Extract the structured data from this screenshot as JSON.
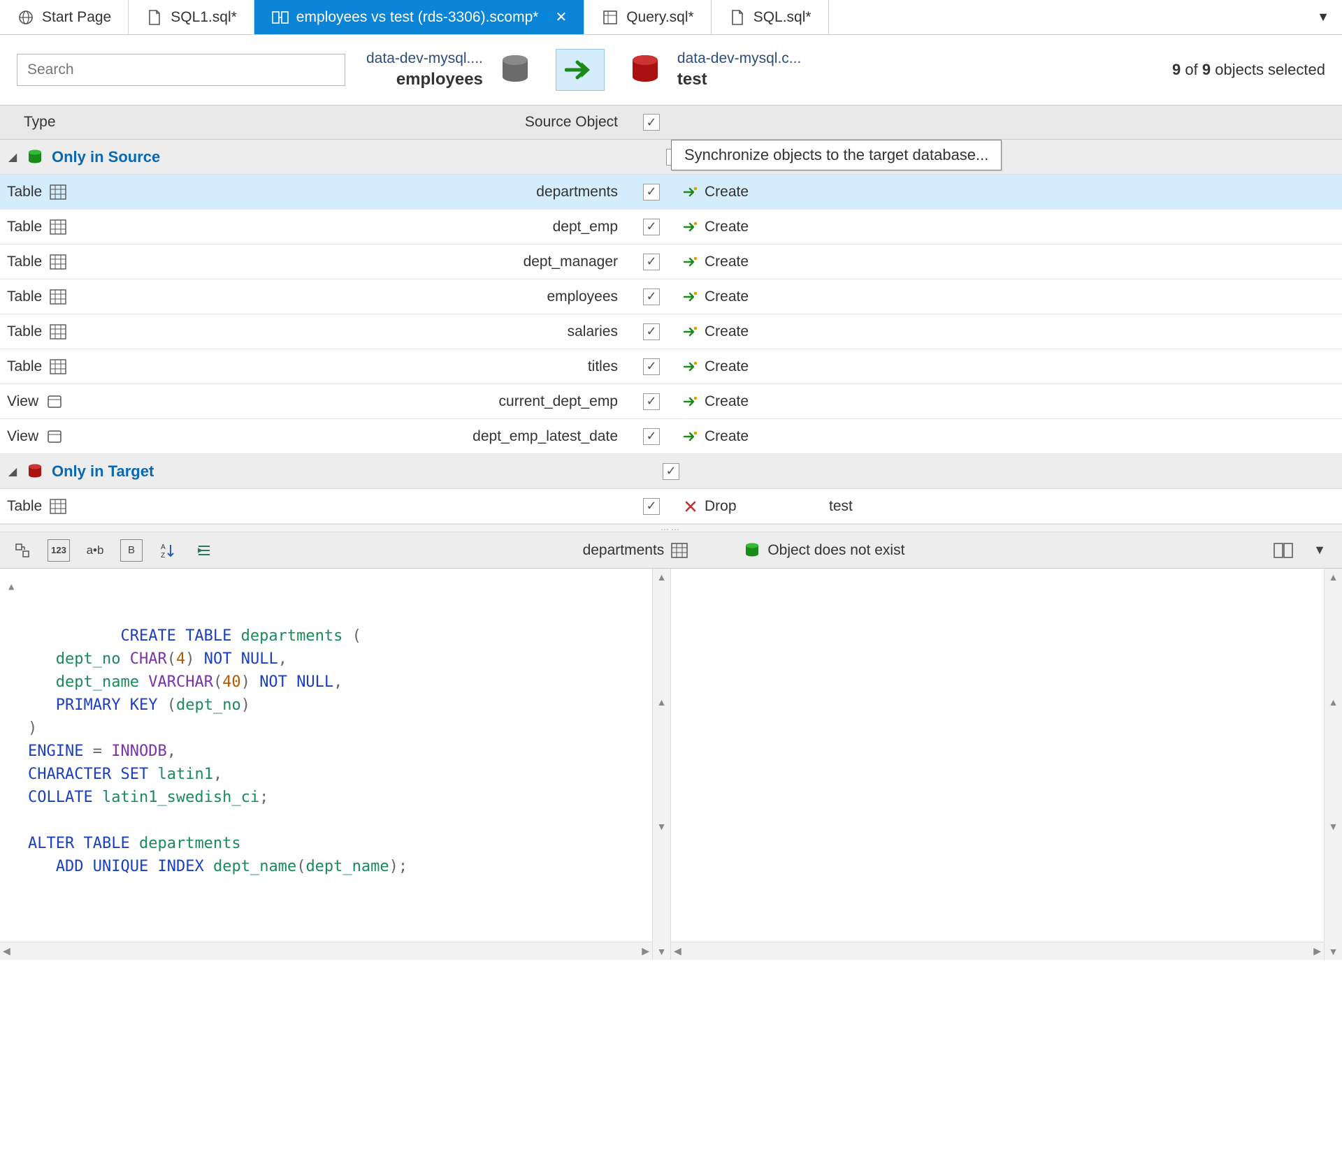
{
  "tabs": [
    {
      "label": "Start Page",
      "icon": "globe"
    },
    {
      "label": "SQL1.sql*",
      "icon": "sqlfile"
    },
    {
      "label": "employees vs test (rds-3306).scomp*",
      "icon": "compare",
      "active": true,
      "closable": true
    },
    {
      "label": "Query.sql*",
      "icon": "query"
    },
    {
      "label": "SQL.sql*",
      "icon": "sqlfile"
    }
  ],
  "search": {
    "placeholder": "Search"
  },
  "source": {
    "server": "data-dev-mysql....",
    "db": "employees"
  },
  "target": {
    "server": "data-dev-mysql.c...",
    "db": "test"
  },
  "sel_count": "9",
  "sel_total": "9",
  "sel_suffix": "objects selected",
  "tooltip": "Synchronize objects to the target database...",
  "cols": {
    "type": "Type",
    "src": "Source Object"
  },
  "groups": {
    "source": "Only in Source",
    "target": "Only in Target"
  },
  "rows_source": [
    {
      "type": "Table",
      "icon": "table",
      "name": "departments",
      "action": "Create",
      "selected": true
    },
    {
      "type": "Table",
      "icon": "table",
      "name": "dept_emp",
      "action": "Create"
    },
    {
      "type": "Table",
      "icon": "table",
      "name": "dept_manager",
      "action": "Create"
    },
    {
      "type": "Table",
      "icon": "table",
      "name": "employees",
      "action": "Create"
    },
    {
      "type": "Table",
      "icon": "table",
      "name": "salaries",
      "action": "Create"
    },
    {
      "type": "Table",
      "icon": "table",
      "name": "titles",
      "action": "Create"
    },
    {
      "type": "View",
      "icon": "view",
      "name": "current_dept_emp",
      "action": "Create"
    },
    {
      "type": "View",
      "icon": "view",
      "name": "dept_emp_latest_date",
      "action": "Create"
    }
  ],
  "rows_target": [
    {
      "type": "Table",
      "icon": "table",
      "name": "",
      "action": "Drop",
      "target_name": "test"
    }
  ],
  "bottom": {
    "left_label": "departments",
    "right_label": "Object does not exist"
  },
  "sql_tokens": [
    [
      "kw",
      "CREATE"
    ],
    [
      "sp",
      " "
    ],
    [
      "kw",
      "TABLE"
    ],
    [
      "sp",
      " "
    ],
    [
      "id",
      "departments"
    ],
    [
      "sp",
      " "
    ],
    [
      "pn",
      "("
    ],
    [
      "nl"
    ],
    [
      "sp",
      "   "
    ],
    [
      "id",
      "dept_no"
    ],
    [
      "sp",
      " "
    ],
    [
      "ty",
      "CHAR"
    ],
    [
      "pn",
      "("
    ],
    [
      "num",
      "4"
    ],
    [
      "pn",
      ")"
    ],
    [
      "sp",
      " "
    ],
    [
      "kw",
      "NOT"
    ],
    [
      "sp",
      " "
    ],
    [
      "kw",
      "NULL"
    ],
    [
      "pn",
      ","
    ],
    [
      "nl"
    ],
    [
      "sp",
      "   "
    ],
    [
      "id",
      "dept_name"
    ],
    [
      "sp",
      " "
    ],
    [
      "ty",
      "VARCHAR"
    ],
    [
      "pn",
      "("
    ],
    [
      "num",
      "40"
    ],
    [
      "pn",
      ")"
    ],
    [
      "sp",
      " "
    ],
    [
      "kw",
      "NOT"
    ],
    [
      "sp",
      " "
    ],
    [
      "kw",
      "NULL"
    ],
    [
      "pn",
      ","
    ],
    [
      "nl"
    ],
    [
      "sp",
      "   "
    ],
    [
      "kw",
      "PRIMARY"
    ],
    [
      "sp",
      " "
    ],
    [
      "kw",
      "KEY"
    ],
    [
      "sp",
      " "
    ],
    [
      "pn",
      "("
    ],
    [
      "id",
      "dept_no"
    ],
    [
      "pn",
      ")"
    ],
    [
      "nl"
    ],
    [
      "pn",
      ")"
    ],
    [
      "nl"
    ],
    [
      "kw",
      "ENGINE"
    ],
    [
      "sp",
      " "
    ],
    [
      "pn",
      "="
    ],
    [
      "sp",
      " "
    ],
    [
      "ty",
      "INNODB"
    ],
    [
      "pn",
      ","
    ],
    [
      "nl"
    ],
    [
      "kw",
      "CHARACTER"
    ],
    [
      "sp",
      " "
    ],
    [
      "kw",
      "SET"
    ],
    [
      "sp",
      " "
    ],
    [
      "id",
      "latin1"
    ],
    [
      "pn",
      ","
    ],
    [
      "nl"
    ],
    [
      "kw",
      "COLLATE"
    ],
    [
      "sp",
      " "
    ],
    [
      "id",
      "latin1_swedish_ci"
    ],
    [
      "pn",
      ";"
    ],
    [
      "nl"
    ],
    [
      "nl"
    ],
    [
      "kw",
      "ALTER"
    ],
    [
      "sp",
      " "
    ],
    [
      "kw",
      "TABLE"
    ],
    [
      "sp",
      " "
    ],
    [
      "id",
      "departments"
    ],
    [
      "nl"
    ],
    [
      "sp",
      "   "
    ],
    [
      "kw",
      "ADD"
    ],
    [
      "sp",
      " "
    ],
    [
      "kw",
      "UNIQUE"
    ],
    [
      "sp",
      " "
    ],
    [
      "kw",
      "INDEX"
    ],
    [
      "sp",
      " "
    ],
    [
      "id",
      "dept_name"
    ],
    [
      "pn",
      "("
    ],
    [
      "id",
      "dept_name"
    ],
    [
      "pn",
      ")"
    ],
    [
      "pn",
      ";"
    ]
  ]
}
